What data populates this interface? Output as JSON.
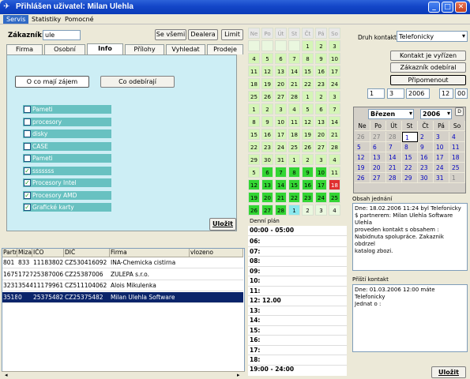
{
  "window": {
    "title": "Přihlášen uživatel: Milan Ulehla"
  },
  "menu": [
    "Servis",
    "Statistiky",
    "Pomocné"
  ],
  "customer": {
    "label": "Zákazník:",
    "value": "ule",
    "btn_all": "Se všemi",
    "btn_dealer": "Dealera",
    "btn_limit": "Limit"
  },
  "tabs": [
    "Firma",
    "Osobní",
    "Info",
    "Přílohy",
    "Vyhledat",
    "Prodeje"
  ],
  "info": {
    "btn_interest": "O co mají zájem",
    "btn_buy": "Co odebírají",
    "save": "Uložit",
    "items": [
      {
        "label": "Pameti",
        "checked": false
      },
      {
        "label": "procesory",
        "checked": false
      },
      {
        "label": "disky",
        "checked": false
      },
      {
        "label": "CASE",
        "checked": false
      },
      {
        "label": "Pameti",
        "checked": false
      },
      {
        "label": "sssssss",
        "checked": true
      },
      {
        "label": "Procesory Intel",
        "checked": true
      },
      {
        "label": "Procesory AMD",
        "checked": true
      },
      {
        "label": "Grafické karty",
        "checked": true
      }
    ]
  },
  "grid": {
    "headers": [
      "Partr",
      "Mizaí",
      "IČO",
      "DIČ",
      "Firma",
      "vlozeno"
    ],
    "rows": [
      [
        "801",
        "833",
        "11183802",
        "CZ530416092",
        "INA-Chemicka cistirna",
        ""
      ],
      [
        "1675",
        "1727",
        "25387006",
        "CZ25387006",
        "ZULEPA s.r.o.",
        ""
      ],
      [
        "3231",
        "3544",
        "11179961",
        "CZ511104062",
        "Alois Mikulenka",
        ""
      ],
      [
        "3518",
        "0",
        "25375482",
        "CZ25375482",
        "Milan Ulehla Software",
        ""
      ]
    ]
  },
  "cal1": {
    "headers": [
      "Ne",
      "Po",
      "Út",
      "St",
      "Čt",
      "Pá",
      "So"
    ],
    "cells": [
      [
        "",
        "",
        "",
        "",
        "1",
        "2",
        "3"
      ],
      [
        "4",
        "5",
        "6",
        "7",
        "8",
        "9",
        "10"
      ],
      [
        "11",
        "12",
        "13",
        "14",
        "15",
        "16",
        "17"
      ],
      [
        "18",
        "19",
        "20",
        "21",
        "22",
        "23",
        "24"
      ],
      [
        "25",
        "26",
        "27",
        "28",
        "1",
        "2",
        "3"
      ],
      [
        "1",
        "2",
        "3",
        "4",
        "5",
        "6",
        "7"
      ],
      [
        "8",
        "9",
        "10",
        "11",
        "12",
        "13",
        "14"
      ],
      [
        "15",
        "16",
        "17",
        "18",
        "19",
        "20",
        "21"
      ],
      [
        "22",
        "23",
        "24",
        "25",
        "26",
        "27",
        "28"
      ],
      [
        "29",
        "30",
        "31",
        "1",
        "2",
        "3",
        "4"
      ],
      [
        "5",
        "6",
        "7",
        "8",
        "9",
        "10",
        "11"
      ],
      [
        "12",
        "13",
        "14",
        "15",
        "16",
        "17",
        "18"
      ],
      [
        "19",
        "20",
        "21",
        "22",
        "23",
        "24",
        "25"
      ],
      [
        "26",
        "27",
        "28",
        "1",
        "2",
        "3",
        "4"
      ]
    ]
  },
  "schedule": {
    "label": "Denní plán",
    "first": "00:00 - 05:00",
    "last": "19:00 - 24:00",
    "hours": [
      "06:",
      "07:",
      "08:",
      "09:",
      "10:",
      "11:",
      "12: 12.00",
      "13:",
      "14:",
      "15:",
      "16:",
      "17:",
      "18:"
    ]
  },
  "contact": {
    "type_label": "Druh kontaktu",
    "type_value": "Telefonicky",
    "btn_done": "Kontakt je vyřízen",
    "btn_bought": "Zákazník odebíral",
    "btn_remind": "Připomenout",
    "date_d": "1",
    "date_m": "3",
    "date_y": "2006",
    "time": "12",
    "time_m": "00",
    "content_label": "Obsah jednání",
    "content": "Dne: 18.02.2006 11:24 byl Telefonicky\n$ partnerem: Milan Ulehla Software\nUlehla\nproveden kontakt s obsahem :\nNabidnuta spolupráce. Zakaznik obdrzel\nkatalog zbozi.",
    "next_label": "Příští kontakt",
    "next": "Dne: 01.03.2006 12:00 máte Telefonicky\nJednat o :",
    "save": "Uložit"
  },
  "cal2": {
    "month": "Březen",
    "year": "2006",
    "headers": [
      "Ne",
      "Po",
      "Út",
      "St",
      "Čt",
      "Pá",
      "So"
    ],
    "cells": [
      [
        "26",
        "27",
        "28",
        "1",
        "2",
        "3",
        "4"
      ],
      [
        "5",
        "6",
        "7",
        "8",
        "9",
        "10",
        "11"
      ],
      [
        "12",
        "13",
        "14",
        "15",
        "16",
        "17",
        "18"
      ],
      [
        "19",
        "20",
        "21",
        "22",
        "23",
        "24",
        "25"
      ],
      [
        "26",
        "27",
        "28",
        "29",
        "30",
        "31",
        "1"
      ]
    ]
  }
}
